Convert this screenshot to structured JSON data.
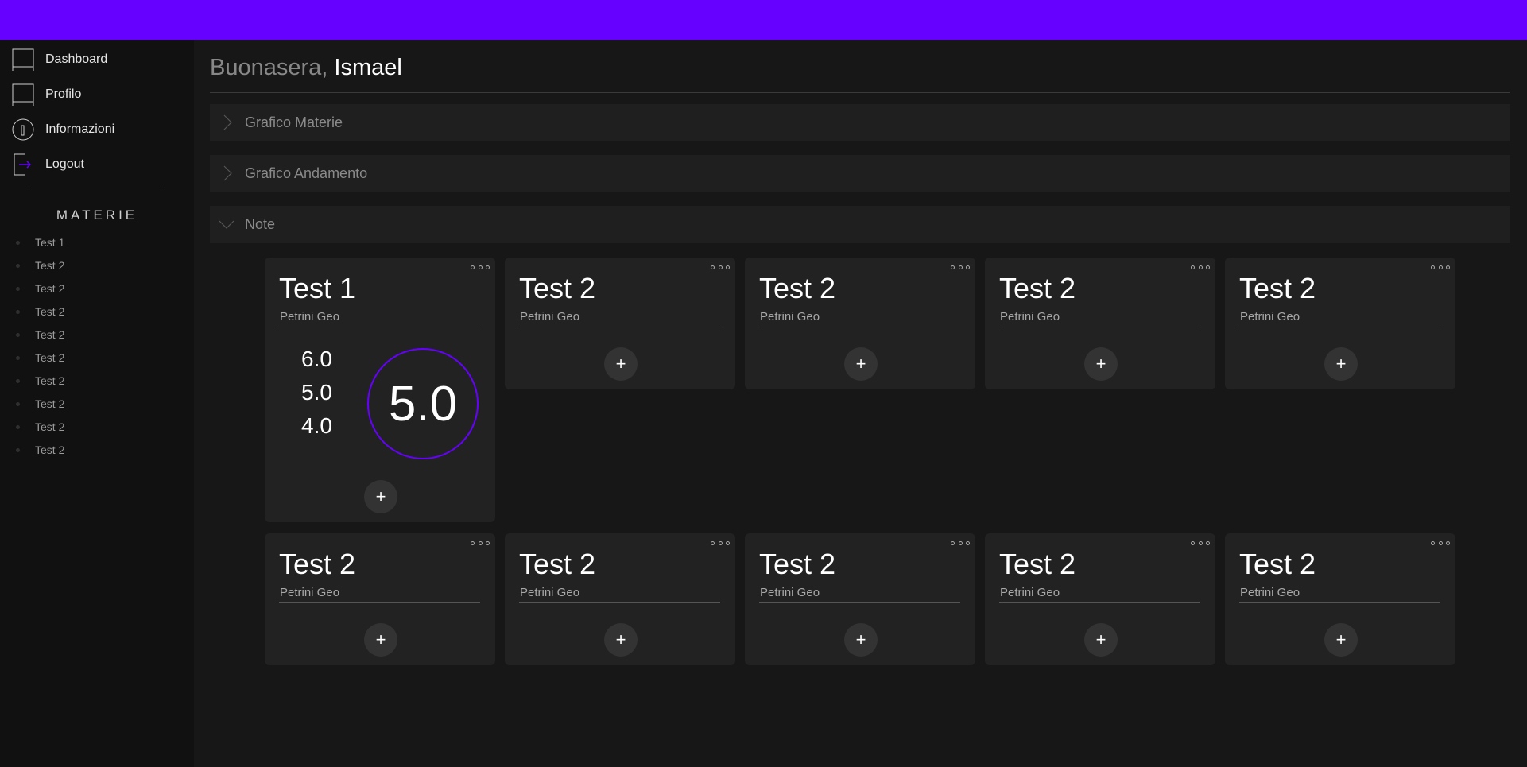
{
  "nav": {
    "items": [
      {
        "label": "Dashboard",
        "icon": "monitor-icon"
      },
      {
        "label": "Profilo",
        "icon": "monitor-icon"
      },
      {
        "label": "Informazioni",
        "icon": "info-icon"
      },
      {
        "label": "Logout",
        "icon": "logout-icon"
      }
    ]
  },
  "materie": {
    "title": "MATERIE",
    "items": [
      "Test 1",
      "Test 2",
      "Test 2",
      "Test 2",
      "Test 2",
      "Test 2",
      "Test 2",
      "Test 2",
      "Test 2",
      "Test 2"
    ]
  },
  "greeting": {
    "prefix": "Buonasera,",
    "name": "Ismael"
  },
  "accordions": [
    {
      "label": "Grafico Materie",
      "expanded": false
    },
    {
      "label": "Grafico Andamento",
      "expanded": false
    },
    {
      "label": "Note",
      "expanded": true
    }
  ],
  "cards": [
    {
      "title": "Test 1",
      "teacher": "Petrini Geo",
      "grades": [
        "6.0",
        "5.0",
        "4.0"
      ],
      "average": "5.0",
      "add_label": "+"
    },
    {
      "title": "Test 2",
      "teacher": "Petrini Geo",
      "add_label": "+"
    },
    {
      "title": "Test 2",
      "teacher": "Petrini Geo",
      "add_label": "+"
    },
    {
      "title": "Test 2",
      "teacher": "Petrini Geo",
      "add_label": "+"
    },
    {
      "title": "Test 2",
      "teacher": "Petrini Geo",
      "add_label": "+"
    },
    {
      "title": "Test 2",
      "teacher": "Petrini Geo",
      "add_label": "+"
    },
    {
      "title": "Test 2",
      "teacher": "Petrini Geo",
      "add_label": "+"
    },
    {
      "title": "Test 2",
      "teacher": "Petrini Geo",
      "add_label": "+"
    },
    {
      "title": "Test 2",
      "teacher": "Petrini Geo",
      "add_label": "+"
    },
    {
      "title": "Test 2",
      "teacher": "Petrini Geo",
      "add_label": "+"
    }
  ],
  "colors": {
    "accent": "#6600ff",
    "background": "#171717",
    "sidebar": "#111111",
    "card": "#222222"
  }
}
